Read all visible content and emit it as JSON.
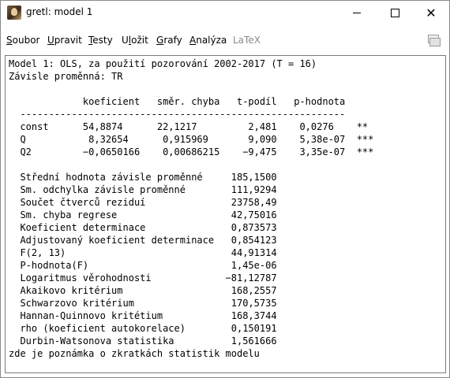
{
  "window": {
    "title": "gretl: model 1",
    "controls": {
      "minimize": "minimize",
      "maximize": "maximize",
      "close": "✕"
    }
  },
  "menu": {
    "items": [
      {
        "label": "Soubor",
        "underline": "S",
        "enabled": true
      },
      {
        "label": "Upravit",
        "underline": "U",
        "enabled": true
      },
      {
        "label": "Testy",
        "underline": "T",
        "enabled": true
      },
      {
        "label": "Uložit",
        "underline": "l",
        "enabled": true
      },
      {
        "label": "Grafy",
        "underline": "G",
        "enabled": true
      },
      {
        "label": "Analýza",
        "underline": "A",
        "enabled": true
      },
      {
        "label": "LaTeX",
        "underline": "",
        "enabled": false
      }
    ],
    "copy_icon": "copy-icon"
  },
  "output": {
    "lines": [
      "Model 1: OLS, za použití pozorování 2002-2017 (T = 16)",
      "Závisle proměnná: TR",
      "",
      "             koeficient   směr. chyba   t-podíl   p-hodnota",
      "  ---------------------------------------------------------",
      "  const      54,8874      22,1217         2,481    0,0276    **",
      "  Q           8,32654      0,915969       9,090    5,38e-07  ***",
      "  Q2         −0,0650166    0,00686215    −9,475    3,35e-07  ***",
      "",
      "  Střední hodnota závisle proměnné     185,1500",
      "  Sm. odchylka závisle proměnné        111,9294",
      "  Součet čtverců reziduí               23758,49",
      "  Sm. chyba regrese                    42,75016",
      "  Koeficient determinace               0,873573",
      "  Adjustovaný koeficient determinace   0,854123",
      "  F(2, 13)                             44,91314",
      "  P-hodnota(F)                         1,45e-06",
      "  Logaritmus věrohodnosti             −81,12787",
      "  Akaikovo kritérium                   168,2557",
      "  Schwarzovo kritérium                 170,5735",
      "  Hannan-Quinnovo kritétium            168,3744",
      "  rho (koeficient autokorelace)        0,150191",
      "  Durbin-Watsonova statistika          1,561666",
      "zde je poznámka o zkratkách statistik modelu"
    ]
  }
}
